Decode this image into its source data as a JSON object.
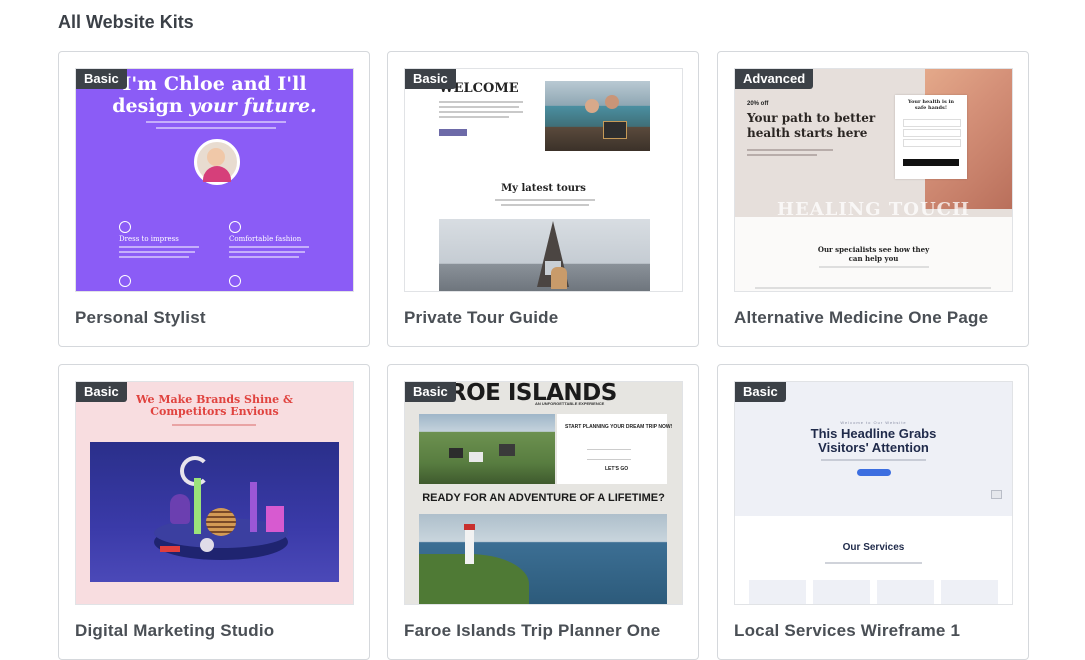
{
  "heading": "All Website Kits",
  "kits": [
    {
      "title": "Personal Stylist",
      "badge": "Basic",
      "preview": {
        "headline_1": "I'm Chloe and I'll",
        "headline_2": "design",
        "headline_3": "your future.",
        "feature_1": "Dress to impress",
        "feature_2": "Comfortable fashion"
      },
      "colors": {
        "bg": "#8b5cf6"
      }
    },
    {
      "title": "Private Tour Guide",
      "badge": "Basic",
      "preview": {
        "headline": "WELCOME",
        "section": "My latest tours"
      }
    },
    {
      "title": "Alternative Medicine One Page",
      "badge": "Advanced",
      "preview": {
        "offer": "20% off",
        "headline": "Your path to better health starts here",
        "form_title": "Your health is in safe hands!",
        "banner": "HEALING TOUCH",
        "section": "Our specialists see how they can help you"
      }
    },
    {
      "title": "Digital Marketing Studio",
      "badge": "Basic",
      "preview": {
        "headline": "We Make Brands Shine & Competitors Envious"
      },
      "colors": {
        "bg": "#f8dde0",
        "accent": "#e0433f"
      }
    },
    {
      "title": "Faroe Islands Trip Planner One",
      "badge": "Basic",
      "preview": {
        "headline": "FAROE ISLANDS",
        "tagline": "AN UNFORGETTABLE EXPERIENCE",
        "form_title": "START PLANNING YOUR DREAM TRIP NOW!",
        "cta": "LET'S GO",
        "banner": "READY FOR AN ADVENTURE OF A LIFETIME?"
      }
    },
    {
      "title": "Local Services Wireframe 1",
      "badge": "Basic",
      "preview": {
        "kicker": "Welcome to Our Website",
        "headline": "This Headline Grabs Visitors' Attention",
        "section": "Our Services"
      }
    }
  ]
}
